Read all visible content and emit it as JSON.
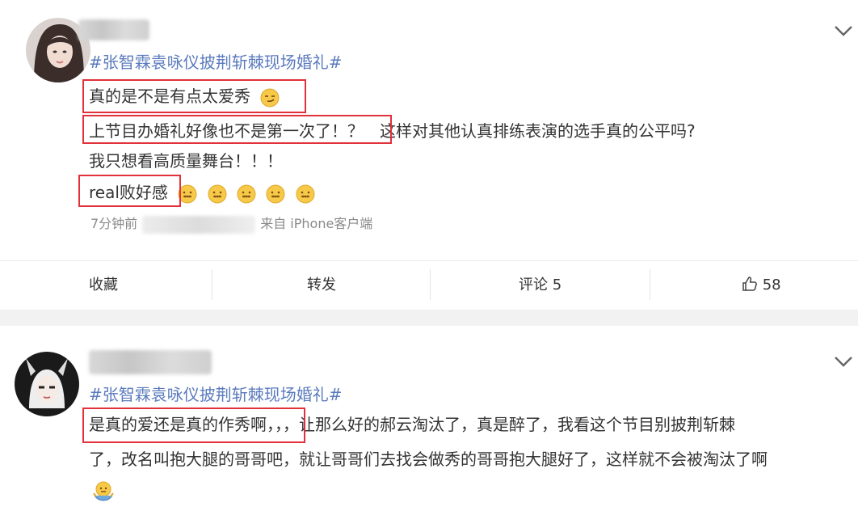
{
  "post1": {
    "hashtag": "#张智霖袁咏仪披荆斩棘现场婚礼#",
    "line1": "真的是不是有点太爱秀",
    "line2_boxed": "上节目办婚礼好像也不是第一次了！？",
    "line2_rest": "这样对其他认真排练表演的选手真的公平吗?",
    "line3": "我只想看高质量舞台！！！",
    "line4": "real败好感",
    "time": "7分钟前",
    "source_prefix": "来自",
    "source": "iPhone客户端"
  },
  "actions": {
    "favorite": "收藏",
    "repost": "转发",
    "comment": "评论 5",
    "like_count": "58"
  },
  "post2": {
    "hashtag": "#张智霖袁咏仪披荆斩棘现场婚礼#",
    "line1_boxed": "是真的爱还是真的作秀啊，",
    "line1_rest": "，，让那么好的郝云淘汰了，真是醉了，我看这个节目别披荆斩棘",
    "line2": "了，改名叫抱大腿的哥哥吧，就让哥哥们去找会做秀的哥哥抱大腿好了，这样就不会被淘汰了啊"
  },
  "icons": [
    "chevron-down-icon",
    "thumbs-up-icon",
    "smirk-emoji-icon",
    "zipper-mouth-emoji-icon",
    "shrug-emoji-icon"
  ],
  "colors": {
    "hashtag": "#5b7bbd",
    "highlight_box": "#e1313a",
    "meta": "#8a8a8a"
  }
}
